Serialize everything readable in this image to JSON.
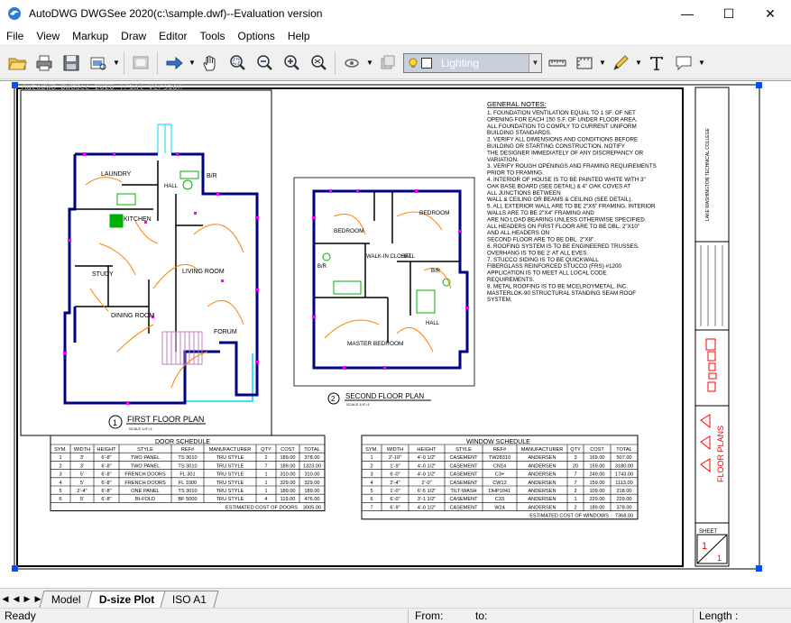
{
  "window": {
    "title": "AutoDWG DWGSee 2020(c:\\sample.dwf)--Evaluation version",
    "minimize": "—",
    "maximize": "☐",
    "close": "✕"
  },
  "menu": [
    "File",
    "View",
    "Markup",
    "Draw",
    "Editor",
    "Tools",
    "Options",
    "Help"
  ],
  "toolbar": {
    "layer_value": "Lighting",
    "icons": [
      "open-folder-icon",
      "print-icon",
      "save-icon",
      "print-preview-icon",
      "page-setup-icon",
      "forward-arrow-icon",
      "pan-hand-icon",
      "zoom-window-icon",
      "zoom-out-icon",
      "zoom-in-icon",
      "zoom-extents-icon",
      "layers-icon",
      "layer-states-icon",
      "measure-distance-icon",
      "measure-area-icon",
      "pen-markup-icon",
      "text-icon",
      "comment-icon"
    ]
  },
  "drawing": {
    "watermark": "AutoDWG DWGSee 2020 Trial Version",
    "first_floor_title": "FIRST FLOOR PLAN",
    "first_floor_num": "1",
    "first_floor_scale": "SCALE 1/4\"=1'",
    "second_floor_title": "SECOND FLOOR PLAN",
    "second_floor_num": "2",
    "second_floor_scale": "SCALE 1/4\"=1'",
    "rooms_first": [
      "LAUNDRY",
      "B/R",
      "HALL",
      "KITCHEN",
      "STUDY",
      "LIVING ROOM",
      "DINING ROOM",
      "FORUM"
    ],
    "rooms_second": [
      "BEDROOM",
      "BEDROOM",
      "B/R",
      "WALK-IN CLOSET",
      "HALL",
      "B/R",
      "HALL",
      "MASTER BEDROOM"
    ],
    "notes_title": "GENERAL NOTES:",
    "notes": [
      "1. FOUNDATION VENTILATION EQUAL TO 1 SF. OF NET",
      "   OPENING FOR EACH 150 S.F. OF UNDER FLOOR AREA.",
      "   ALL FOUNDATION TO COMPLY TO CURRENT UNIFORM",
      "   BUILDING STANDARDS.",
      "2. VERIFY ALL DIMENSIONS AND CONDITIONS BEFORE",
      "   BUILDING OR STARTING CONSTRUCTION. NOTIFY",
      "   THE DESIGNER IMMEDIATELY OF ANY DISCREPANCY OR",
      "   VARIATION.",
      "3. VERIFY ROUGH OPENINGS AND FRAMING REQUIREMENTS",
      "   PRIOR TO FRAMING.",
      "4. INTERIOR OF HOUSE IS TO BE PAINTED WHITE WITH 3\"",
      "   OAK  BASE BOARD (SEE DETAIL) & 4\" OAK COVES AT",
      "   ALL JUNCTIONS BETWEEN",
      "   WALL & CEILING OR BEAMS & CEILING (SEE DETAIL).",
      "5. ALL EXTERIOR WALL ARE TO BE 2\"X6\" FRAMING, INTERIOR",
      "   WALLS ARE TO BE 2\"X4\" FRAMING AND",
      "   ARE NO LOAD BEARING UNLESS OTHERWISE SPECIFIED.",
      "   ALL HEADERS ON FIRST FLOOR ARE TO BE DBL. 2\"X10\"",
      "   AND ALL HEADERS ON",
      "   SECOND FLOOR ARE TO BE DBL. 2\"X8\".",
      "6. ROOFING SYSTEM IS TO BE ENGINEERED TRUSSES.",
      "   OVERHANG IS TO BE 2' AT ALL EVES.",
      "7. STUCCO SIDING IS TO BE QUICKWALL",
      "   FIBERGLASS REINFORCED STUCCO (FRS) #1200",
      "   APPLICATION IS TO MEET ALL LOCAL CODE",
      "   REQUIREMENTS.",
      "8. METAL ROOFING IS TO BE MCELROYMETAL, INC.",
      "   MASTERLOK-90 STRUCTURAL STANDING SEAM ROOF",
      "   SYSTEM."
    ],
    "door_schedule": {
      "title": "DOOR SCHEDULE",
      "headers": [
        "SYM.",
        "WIDTH",
        "HEIGHT",
        "STYLE",
        "REF#",
        "MANUFACTURER",
        "QTY",
        "COST",
        "TOTAL"
      ],
      "rows": [
        [
          "1",
          "3'",
          "6'-8\"",
          "TWO PANEL",
          "TS 3010",
          "TRU STYLE",
          "2",
          "189.00",
          "378.00"
        ],
        [
          "2",
          "3'",
          "6'-8\"",
          "TWO PANEL",
          "TS 3010",
          "TRU STYLE",
          "7",
          "189.00",
          "1323.00"
        ],
        [
          "3",
          "5'",
          "6'-8\"",
          "FRENCH DOORS",
          "FL 301",
          "TRU STYLE",
          "1",
          "310.00",
          "310.00"
        ],
        [
          "4",
          "5'",
          "6'-8\"",
          "FRENCH DOORS",
          "FL 1000",
          "TRU STYLE",
          "1",
          "329.00",
          "329.00"
        ],
        [
          "5",
          "2'-4\"",
          "6'-8\"",
          "ONE PANEL",
          "TS 3010",
          "TRU STYLE",
          "1",
          "189.00",
          "189.00"
        ],
        [
          "6",
          "5'",
          "6'-8\"",
          "BI-FOLD",
          "BF 5000",
          "TRU STYLE",
          "4",
          "119.00",
          "476.00"
        ]
      ],
      "footer_label": "ESTIMATED COST OF DOORS",
      "footer_value": "3005.00"
    },
    "window_schedule": {
      "title": "WINDOW SCHEDULE",
      "headers": [
        "SYM.",
        "WIDTH",
        "HEIGHT",
        "STYLE",
        "REF#",
        "MANUFACTURER",
        "QTY",
        "COST",
        "TOTAL"
      ],
      "rows": [
        [
          "1",
          "2'-10\"",
          "4'-0 1/2\"",
          "CASEMENT",
          "TW28310",
          "ANDERSEN",
          "3",
          "169.00",
          "507.00"
        ],
        [
          "2",
          "1'-9\"",
          "4'-0 1/2\"",
          "CASEMENT",
          "CN14",
          "ANDERSEN",
          "20",
          "159.00",
          "3180.00"
        ],
        [
          "3",
          "6'-0\"",
          "4'-0 1/2\"",
          "CASEMENT",
          "C3+",
          "ANDERSEN",
          "7",
          "249.00",
          "1743.00"
        ],
        [
          "4",
          "2'-4\"",
          "2'-0\"",
          "CASEMENT",
          "CW12",
          "ANDERSEN",
          "7",
          "159.00",
          "1113.00"
        ],
        [
          "5",
          "1'-0\"",
          "6'-5 1/2\"",
          "TILT-WASH",
          "DHP1041",
          "ANDERSEN",
          "2",
          "109.00",
          "218.00"
        ],
        [
          "6",
          "6'-0\"",
          "3'-1 1/2\"",
          "CASEMENT",
          "C33",
          "ANDERSEN",
          "1",
          "229.00",
          "229.00"
        ],
        [
          "7",
          "6'-9\"",
          "4'-0 1/2\"",
          "CASEMENT",
          "W24",
          "ANDERSEN",
          "2",
          "189.00",
          "378.00"
        ]
      ],
      "footer_label": "ESTIMATED COST OF WINDOWS",
      "footer_value": "7368.00"
    },
    "title_block": {
      "school": "LAKE WASHINGTON TECHNICAL COLLEGE",
      "sheet_title": "FLOOR PLANS",
      "sheet_label": "SHEET",
      "sheet_num": "1",
      "sheet_of": "1"
    }
  },
  "tabs": [
    "Model",
    "D-size Plot",
    "ISO A1"
  ],
  "active_tab": "D-size Plot",
  "status": {
    "ready": "Ready",
    "from": "From:",
    "to": "to:",
    "length": "Length :"
  },
  "colors": {
    "wall": "#000080",
    "door": "#ff8000",
    "marker": "#ff00ff",
    "fixture": "#00b000",
    "porch": "#00d8e8",
    "handle": "#0050ff",
    "stairs": "#c080c0",
    "markup_red": "#ff0000"
  }
}
